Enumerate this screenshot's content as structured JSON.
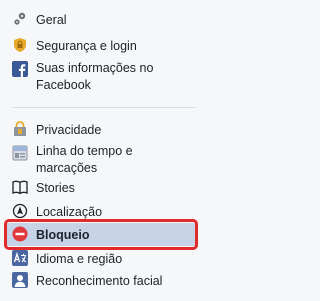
{
  "menu": {
    "items": [
      {
        "id": "geral",
        "label": "Geral",
        "icon": "gears-icon"
      },
      {
        "id": "seguranca",
        "label": "Segurança e login",
        "icon": "shield-icon"
      },
      {
        "id": "informacoes",
        "label": "Suas informações no Facebook",
        "icon": "facebook-icon"
      },
      {
        "id": "privacidade",
        "label": "Privacidade",
        "icon": "lock-icon"
      },
      {
        "id": "linha",
        "label": "Linha do tempo e marcações",
        "icon": "timeline-icon"
      },
      {
        "id": "stories",
        "label": "Stories",
        "icon": "book-icon"
      },
      {
        "id": "localizacao",
        "label": "Localização",
        "icon": "location-icon"
      },
      {
        "id": "bloqueio",
        "label": "Bloqueio",
        "icon": "block-icon"
      },
      {
        "id": "idioma",
        "label": "Idioma e região",
        "icon": "language-icon"
      },
      {
        "id": "reconhecimento",
        "label": "Reconhecimento facial",
        "icon": "face-icon"
      }
    ],
    "selected": "Bloqueio"
  },
  "colors": {
    "selected_bg": "#c7d3e6",
    "highlight_border": "#e02b2b",
    "facebook_blue": "#3b5998",
    "block_red": "#e0393e"
  }
}
